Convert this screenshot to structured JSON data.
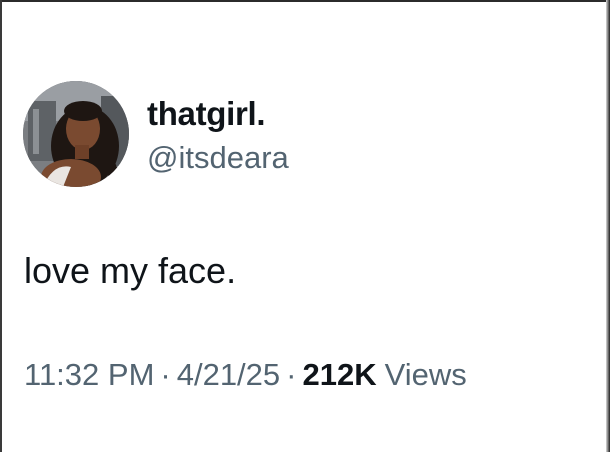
{
  "tweet": {
    "author": {
      "display_name": "thatgirl.",
      "handle": "@itsdeara",
      "avatar_icon": "profile-photo"
    },
    "text": "love my face.",
    "time": "11:32 PM",
    "separator": "·",
    "date": "4/21/25",
    "views_count": "212K",
    "views_label": "Views"
  },
  "colors": {
    "background": "#ffffff",
    "primary_text": "#0f1419",
    "secondary_text": "#536471"
  }
}
